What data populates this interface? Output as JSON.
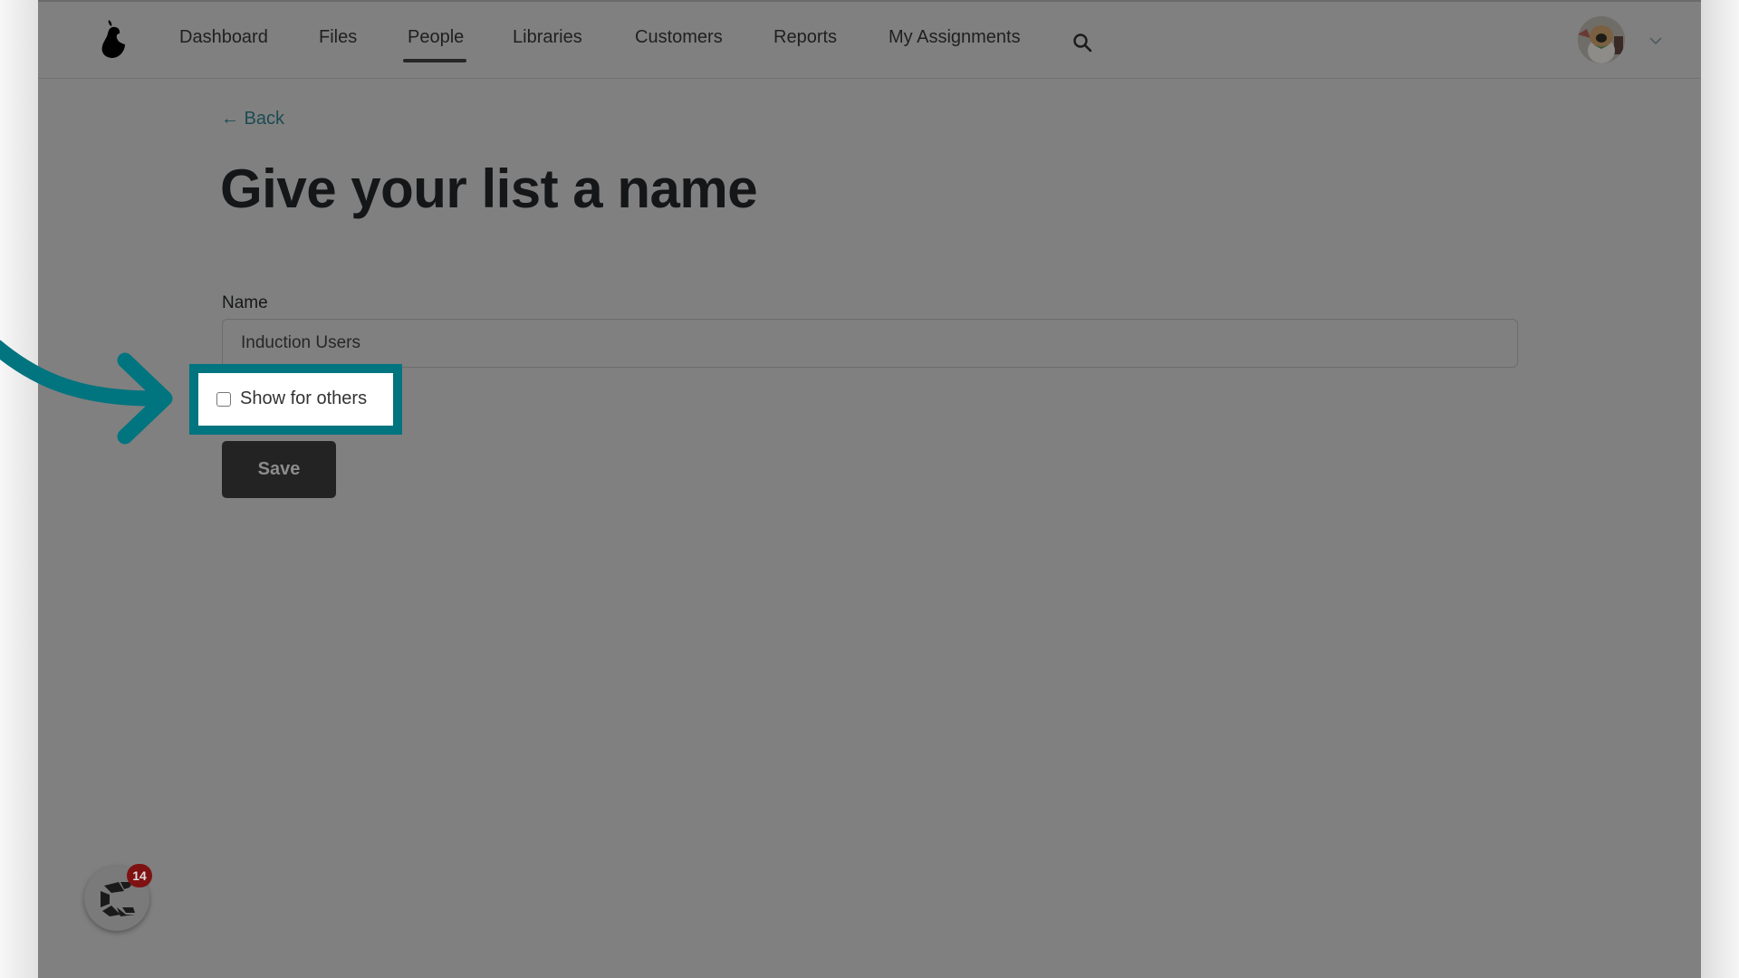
{
  "app": {
    "logo": "pear-logo"
  },
  "nav": {
    "items": [
      {
        "label": "Dashboard",
        "active": false
      },
      {
        "label": "Files",
        "active": false
      },
      {
        "label": "People",
        "active": true
      },
      {
        "label": "Libraries",
        "active": false
      },
      {
        "label": "Customers",
        "active": false
      },
      {
        "label": "Reports",
        "active": false
      },
      {
        "label": "My Assignments",
        "active": false
      }
    ],
    "search_icon": "search-icon",
    "user_menu_icon": "chevron-down-icon"
  },
  "page": {
    "back_label": "← Back",
    "title": "Give your list a name"
  },
  "form": {
    "name_label": "Name",
    "name_value": "Induction Users",
    "show_for_others_label": "Show for others",
    "show_for_others_checked": false,
    "save_label": "Save"
  },
  "annotation": {
    "highlight_color": "#00747f",
    "arrow_color": "#00747f"
  },
  "widget": {
    "badge_count": "14",
    "badge_color": "#7e1212"
  }
}
